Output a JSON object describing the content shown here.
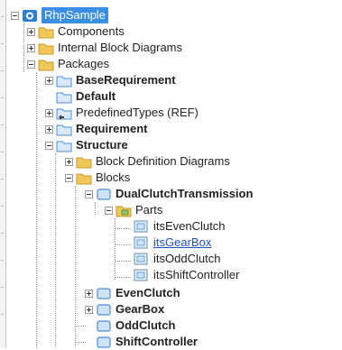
{
  "tree": {
    "root": "RhpSample",
    "components": "Components",
    "internal_block_diagrams": "Internal Block Diagrams",
    "packages": "Packages",
    "base_requirement": "BaseRequirement",
    "default": "Default",
    "predefined_types": "PredefinedTypes (REF)",
    "requirement": "Requirement",
    "structure": "Structure",
    "block_definition_diagrams": "Block Definition Diagrams",
    "blocks": "Blocks",
    "dual_clutch_transmission": "DualClutchTransmission",
    "parts": "Parts",
    "parts_items": [
      "itsEvenClutch",
      "itsGearBox",
      "itsOddClutch",
      "itsShiftController"
    ],
    "even_clutch": "EvenClutch",
    "gear_box": "GearBox",
    "odd_clutch": "OddClutch",
    "shift_controller": "ShiftController"
  },
  "colors": {
    "folder": "#f0c85a",
    "package": "#4a90d9",
    "selection": "#3a8ee6",
    "link": "#2050c8"
  }
}
